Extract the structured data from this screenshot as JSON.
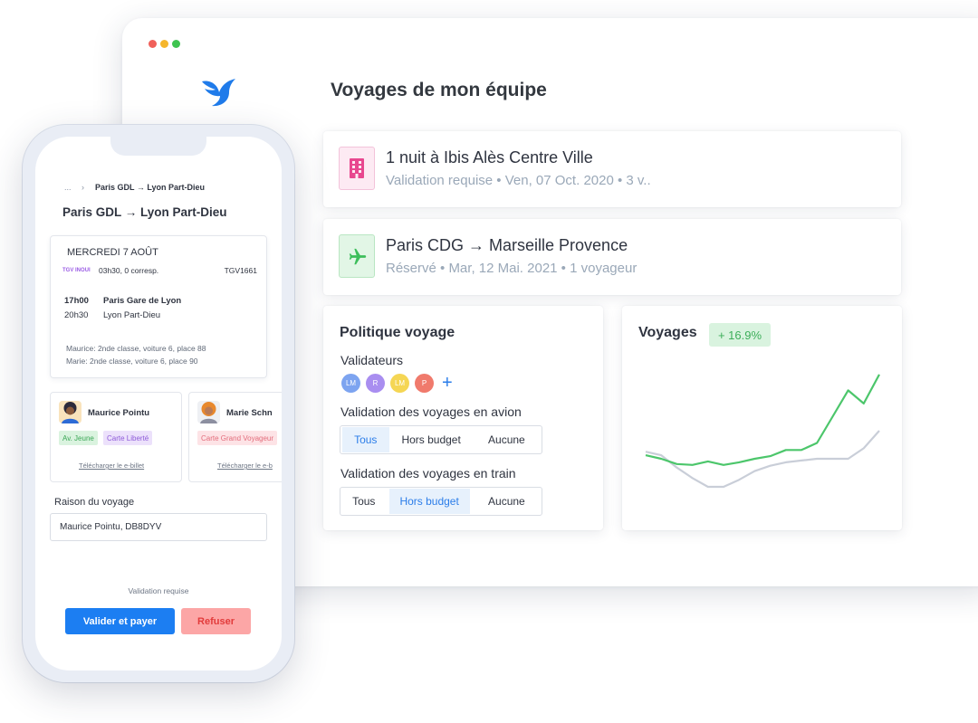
{
  "desktop": {
    "page_title": "Voyages de mon équipe",
    "trips": [
      {
        "icon": "building-icon",
        "title": "1 nuit à Ibis Alès Centre Ville",
        "subtitle": "Validation requise • Ven, 07 Oct. 2020 • 3 v..",
        "color": "#e8478f"
      },
      {
        "icon": "airplane-icon",
        "title": "Paris CDG → Marseille Provence",
        "subtitle": "Réservé • Mar, 12 Mai. 2021 • 1 voyageur",
        "color": "#3dbe5b"
      }
    ],
    "policy": {
      "title": "Politique voyage",
      "validators_label": "Validateurs",
      "validators": [
        {
          "initials": "LM",
          "color": "#7da4f0"
        },
        {
          "initials": "R",
          "color": "#a98ef0"
        },
        {
          "initials": "LM",
          "color": "#f5d654"
        },
        {
          "initials": "P",
          "color": "#f07a6c"
        }
      ],
      "add_symbol": "+",
      "avion_label": "Validation des voyages en avion",
      "avion_options": [
        "Tous",
        "Hors budget",
        "Aucune"
      ],
      "avion_selected": "Tous",
      "train_label": "Validation des voyages en train",
      "train_options": [
        "Tous",
        "Hors budget",
        "Aucune"
      ],
      "train_selected": "Hors budget"
    },
    "voyages_chart": {
      "title": "Voyages",
      "growth": "+ 16.9%"
    }
  },
  "chart_data": {
    "type": "line",
    "title": "Voyages",
    "series": [
      {
        "color": "#4cc66b",
        "values": [
          36,
          32,
          26,
          25,
          29,
          25,
          28,
          32,
          35,
          42,
          42,
          50,
          80,
          110,
          95,
          128
        ]
      },
      {
        "color": "#c9ced8",
        "values": [
          40,
          36,
          22,
          10,
          0,
          0,
          8,
          18,
          24,
          28,
          30,
          32,
          32,
          32,
          44,
          64
        ]
      }
    ],
    "ylim": [
      0,
      130
    ],
    "xlabel": "",
    "ylabel": "",
    "grid": false
  },
  "phone": {
    "breadcrumb": {
      "ellipsis": "...",
      "separator": "›",
      "current": "Paris GDL → Lyon Part-Dieu"
    },
    "route_title": "Paris GDL → Lyon Part-Dieu",
    "ticket": {
      "date": "MERCREDI 7 AOÛT",
      "brand": "TGV INOUI",
      "duration": "03h30, 0 corresp.",
      "train_number": "TGV1661",
      "departure_time": "17h00",
      "departure_place": "Paris Gare de Lyon",
      "arrival_time": "20h30",
      "arrival_place": "Lyon Part-Dieu",
      "seats": [
        "Maurice: 2nde classe, voiture 6, place 88",
        "Marie: 2nde classe, voiture 6, place 90"
      ]
    },
    "passengers": [
      {
        "name": "Maurice Pointu",
        "badges": [
          "Av. Jeune",
          "Carte Liberté"
        ],
        "link": "Télécharger le e-billet"
      },
      {
        "name": "Marie Schn",
        "badges": [
          "Carte Grand Voyageur"
        ],
        "link": "Télécharger le e-b"
      }
    ],
    "reason_label": "Raison du voyage",
    "reason_value": "Maurice Pointu, DB8DYV",
    "validation_status": "Validation requise",
    "validate_button": "Valider et payer",
    "refuse_button": "Refuser"
  }
}
